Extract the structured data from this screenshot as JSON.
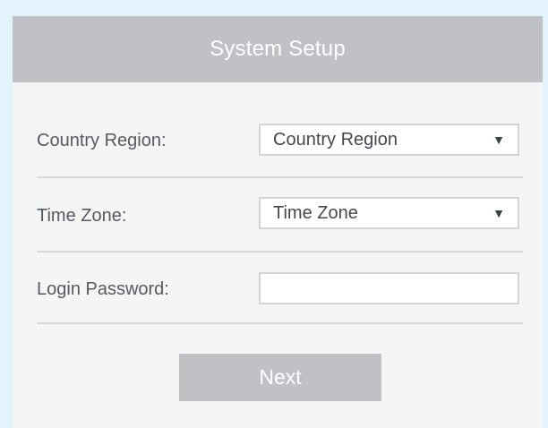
{
  "header": {
    "title": "System Setup"
  },
  "form": {
    "country": {
      "label": "Country Region:",
      "selected": "Country Region",
      "icon": "caret-down-icon"
    },
    "timezone": {
      "label": "Time Zone:",
      "selected": "Time Zone",
      "icon": "caret-down-icon"
    },
    "password": {
      "label": "Login Password:",
      "value": ""
    }
  },
  "actions": {
    "next_label": "Next"
  },
  "colors": {
    "page_background": "#e3f3fb",
    "panel_background": "#f4f6f6",
    "header_background": "#bfc1c4",
    "button_background": "#bfc1c4",
    "text": "#555a5e"
  }
}
